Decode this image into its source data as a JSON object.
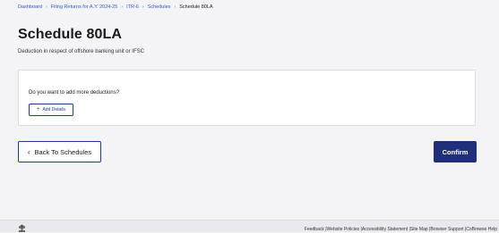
{
  "breadcrumb": {
    "items": [
      "Dashboard",
      "Filing Returns for A.Y. 2024-25",
      "ITR-6",
      "Schedules"
    ],
    "current": "Schedule 80LA",
    "separator": "›"
  },
  "page": {
    "title": "Schedule 80LA",
    "subtitle": "Deduction in respect of offshore banking unit or IFSC"
  },
  "card": {
    "question": "Do you want to add more deductions?",
    "add_details_label": "Add Details",
    "add_icon": "+"
  },
  "actions": {
    "back_label": "Back To Schedules",
    "back_icon": "‹",
    "confirm_label": "Confirm"
  },
  "footer": {
    "links_text": "Feedback |Website Policies |Accessibility Statement |Site Map |Browser Support |CoBrowse Help"
  },
  "colors": {
    "primary": "#1f2f7a",
    "link": "#2a5bd7",
    "background": "#f4f4f7"
  }
}
